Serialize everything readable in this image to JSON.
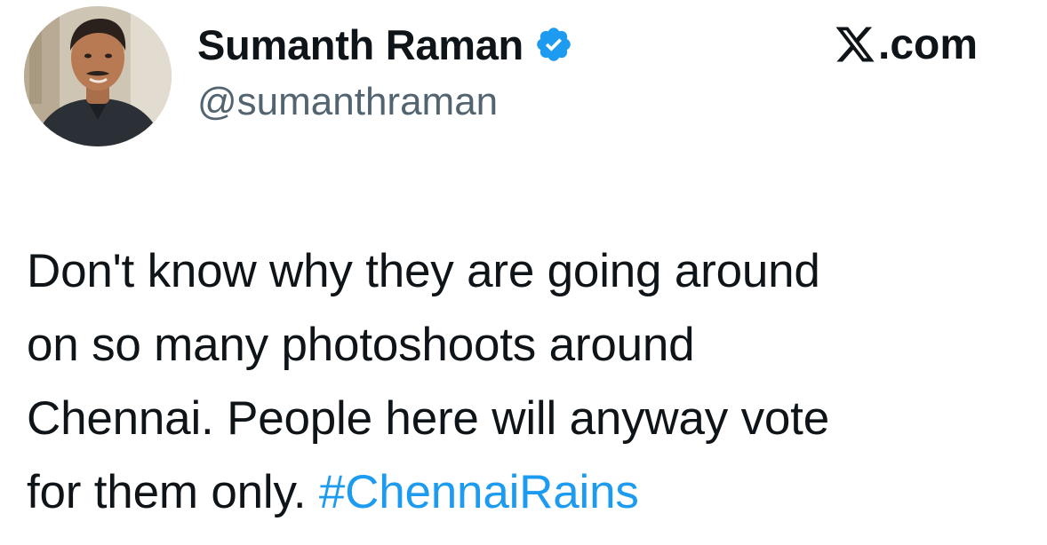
{
  "author": {
    "display_name": "Sumanth Raman",
    "handle": "@sumanthraman",
    "verified": true,
    "verified_icon": "verified-badge-icon",
    "avatar_icon": "profile-photo"
  },
  "source": {
    "logo_icon": "x-logo-icon",
    "label": ".com"
  },
  "tweet": {
    "lines": [
      "Don't know why they are going around",
      "on so many photoshoots around",
      "Chennai. People here will anyway vote",
      "for them only. "
    ],
    "hashtag": "#ChennaiRains"
  },
  "colors": {
    "text": "#0f1419",
    "secondary_text": "#536471",
    "accent": "#1d9bf0",
    "background": "#ffffff"
  }
}
